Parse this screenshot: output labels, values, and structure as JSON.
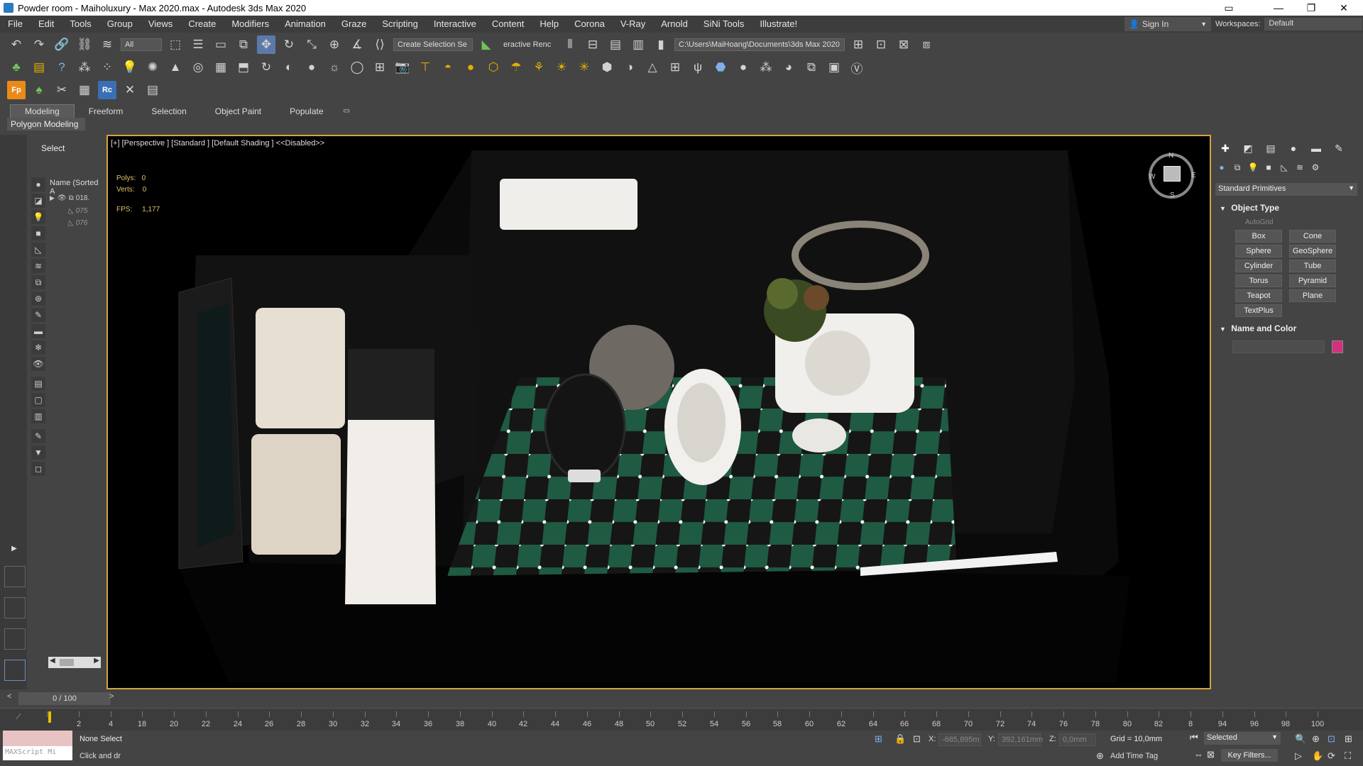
{
  "window": {
    "title": "Powder room - Maiholuxury - Max 2020.max - Autodesk 3ds Max 2020"
  },
  "menu": [
    "File",
    "Edit",
    "Tools",
    "Group",
    "Views",
    "Create",
    "Modifiers",
    "Animation",
    "Graze",
    "Scripting",
    "Interactive",
    "Content",
    "Help",
    "Corona",
    "V-Ray",
    "Arnold",
    "SiNi Tools",
    "Illustrate!"
  ],
  "account": {
    "sign_in": "Sign In",
    "workspaces_label": "Workspaces:",
    "workspace_value": "Default"
  },
  "toolbar": {
    "filter_value": "All",
    "selection_set": "Create Selection Se",
    "interactive_rend": "eractive Renc",
    "project_path": "C:\\Users\\MaiHoang\\Documents\\3ds Max 2020"
  },
  "ribbon": {
    "tabs": [
      "Modeling",
      "Freeform",
      "Selection",
      "Object Paint",
      "Populate"
    ],
    "sub": "Polygon Modeling"
  },
  "explorer": {
    "select_label": "Select",
    "column_header": "Name (Sorted A",
    "rows": [
      {
        "label": "018."
      },
      {
        "label": "075"
      },
      {
        "label": "076"
      }
    ]
  },
  "viewport": {
    "label": "[+] [Perspective ] [Standard ] [Default Shading ]  <<Disabled>>",
    "polys_label": "Polys:",
    "polys_value": "0",
    "verts_label": "Verts:",
    "verts_value": "0",
    "fps_label": "FPS:",
    "fps_value": "1,177",
    "viewcube": {
      "n": "N",
      "s": "S",
      "w": "W",
      "e": "E"
    }
  },
  "command_panel": {
    "primitive_type": "Standard Primitives",
    "object_type_header": "Object Type",
    "autogrid": "AutoGrid",
    "buttons": [
      "Box",
      "Cone",
      "Sphere",
      "GeoSphere",
      "Cylinder",
      "Tube",
      "Torus",
      "Pyramid",
      "Teapot",
      "Plane",
      "TextPlus"
    ],
    "name_color_header": "Name and Color",
    "object_color": "#d4307d"
  },
  "timeline": {
    "frame_display": "0 / 100",
    "ticks": [
      "0",
      "2",
      "4",
      "18",
      "20",
      "22",
      "24",
      "26",
      "28",
      "30",
      "32",
      "34",
      "36",
      "38",
      "40",
      "42",
      "44",
      "46",
      "48",
      "50",
      "52",
      "54",
      "56",
      "58",
      "60",
      "62",
      "64",
      "66",
      "68",
      "70",
      "72",
      "74",
      "76",
      "78",
      "80",
      "82",
      "8",
      "94",
      "96",
      "98",
      "100"
    ]
  },
  "status": {
    "maxscript_placeholder": "MAXScript Mi",
    "selection_text": "None Select",
    "prompt_text": "Click and dr",
    "x_label": "X:",
    "x_value": "-685,895m",
    "y_label": "Y:",
    "y_value": "392,161mm",
    "z_label": "Z:",
    "z_value": "0,0mm",
    "grid": "Grid = 10,0mm",
    "add_time_tag": "Add Time Tag",
    "selected_value": "Selected",
    "key_filters": "Key Filters..."
  }
}
